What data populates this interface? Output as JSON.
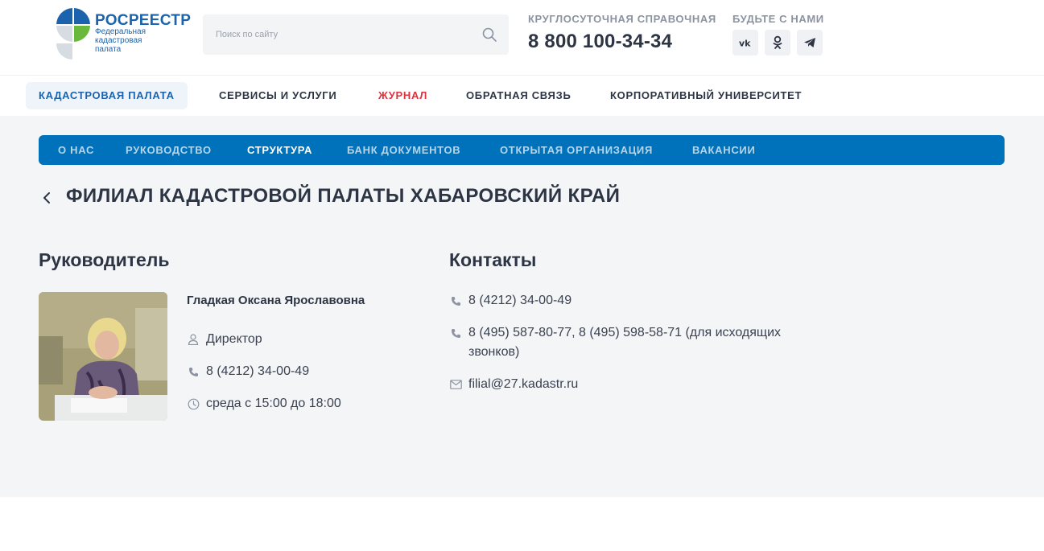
{
  "header": {
    "logo_name": "РОСРЕЕСТР",
    "logo_subtitle": "Федеральная кадастровая палата",
    "search_placeholder": "Поиск по сайту",
    "helpline_label": "КРУГЛОСУТОЧНАЯ СПРАВОЧНАЯ",
    "helpline_phone": "8 800 100-34-34",
    "social_label": "БУДЬТЕ С НАМИ",
    "social": [
      {
        "label": "vk",
        "icon": "vk-icon"
      },
      {
        "label": "ok",
        "icon": "odnoklassniki-icon"
      },
      {
        "label": "telegram",
        "icon": "telegram-icon"
      }
    ]
  },
  "main_nav": [
    {
      "label": "КАДАСТРОВАЯ ПАЛАТА",
      "state": "active"
    },
    {
      "label": "СЕРВИСЫ И УСЛУГИ"
    },
    {
      "label": "ЖУРНАЛ",
      "state": "highlight"
    },
    {
      "label": "ОБРАТНАЯ СВЯЗЬ"
    },
    {
      "label": "КОРПОРАТИВНЫЙ УНИВЕРСИТЕТ"
    }
  ],
  "sub_nav": [
    {
      "label": "О НАС"
    },
    {
      "label": "РУКОВОДСТВО"
    },
    {
      "label": "СТРУКТУРА",
      "state": "current"
    },
    {
      "label": "БАНК ДОКУМЕНТОВ"
    },
    {
      "label": "ОТКРЫТАЯ ОРГАНИЗАЦИЯ"
    },
    {
      "label": "ВАКАНСИИ"
    }
  ],
  "page": {
    "title": "ФИЛИАЛ КАДАСТРОВОЙ ПАЛАТЫ ХАБАРОВСКИЙ КРАЙ"
  },
  "manager": {
    "section_title": "Руководитель",
    "name": "Гладкая Оксана Ярославовна",
    "position": "Директор",
    "phone": "8 (4212) 34-00-49",
    "reception": "среда с 15:00 до 18:00"
  },
  "contacts": {
    "section_title": "Контакты",
    "phone_main": "8 (4212) 34-00-49",
    "phone_outgoing": "8 (495) 587-80-77, 8 (495) 598-58-71 (для исходящих звонков)",
    "email": "filial@27.kadastr.ru"
  },
  "colors": {
    "brand_blue": "#1b63ad",
    "sub_nav_bg": "#0072bc",
    "journal_red": "#d9343f",
    "content_bg": "#f4f5f7"
  }
}
